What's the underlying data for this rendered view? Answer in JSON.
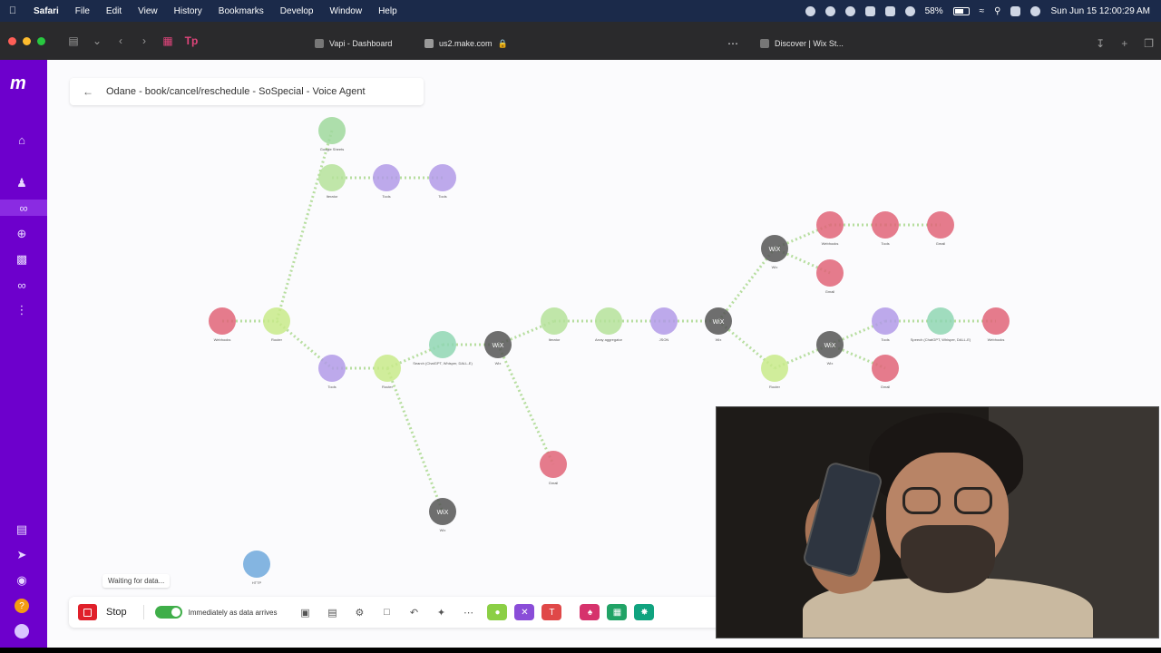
{
  "menubar": {
    "app_name": "Safari",
    "menus": [
      "File",
      "Edit",
      "View",
      "History",
      "Bookmarks",
      "Develop",
      "Window",
      "Help"
    ],
    "battery": "58%",
    "clock": "Sun Jun 15  12:00:29 AM"
  },
  "browser": {
    "tabs": [
      {
        "label": "Vapi - Dashboard"
      },
      {
        "label": "us2.make.com"
      },
      {
        "label": "Discover | Wix St..."
      }
    ]
  },
  "scenario": {
    "title": "Odane - book/cancel/reschedule - SoSpecial - Voice Agent",
    "waiting_text": "Waiting for data...",
    "nodes": [
      {
        "label": "Google Sheets",
        "color": "#9fd89c"
      },
      {
        "label": "Iterator",
        "color": "#b5e29a"
      },
      {
        "label": "Tools",
        "color": "#b29ae8"
      },
      {
        "label": "Tools",
        "color": "#b29ae8"
      },
      {
        "label": "Webhooks",
        "color": "#e06478"
      },
      {
        "label": "Router",
        "color": "#c8ea8a"
      },
      {
        "label": "Tools",
        "color": "#b29ae8"
      },
      {
        "label": "Router",
        "color": "#c8ea8a"
      },
      {
        "label": "Search (ChatGPT, Whisper, DALL-E)",
        "color": "#8fd6b3"
      },
      {
        "label": "Wix",
        "color": "#555555",
        "text": "WiX"
      },
      {
        "label": "Iterator",
        "color": "#b5e29a"
      },
      {
        "label": "Array aggregator",
        "color": "#b5e29a"
      },
      {
        "label": "JSON",
        "color": "#b29ae8"
      },
      {
        "label": "Wix",
        "color": "#555555",
        "text": "WiX"
      },
      {
        "label": "Wix",
        "color": "#555555",
        "text": "WiX"
      },
      {
        "label": "Webhooks",
        "color": "#e06478"
      },
      {
        "label": "Tools",
        "color": "#e06478"
      },
      {
        "label": "Gmail",
        "color": "#e06478"
      },
      {
        "label": "Gmail",
        "color": "#e06478"
      },
      {
        "label": "Wix",
        "color": "#555555",
        "text": "WiX"
      },
      {
        "label": "Tools",
        "color": "#b29ae8"
      },
      {
        "label": "Speech (ChatGPT, Whisper, DALL-E)",
        "color": "#8fd6b3"
      },
      {
        "label": "Webhooks",
        "color": "#e06478"
      },
      {
        "label": "Gmail",
        "color": "#e06478"
      },
      {
        "label": "Router",
        "color": "#c8ea8a"
      },
      {
        "label": "Gmail",
        "color": "#e06478"
      },
      {
        "label": "Wix",
        "color": "#555555",
        "text": "WiX"
      },
      {
        "label": "HTTP",
        "color": "#6fa8dc"
      }
    ]
  },
  "controls": {
    "stop_label": "Stop",
    "schedule_label": "Immediately as data arrives",
    "schedule_on": true
  },
  "colors": {
    "sidebar": "#6d00cc",
    "stop": "#e0202a",
    "toggle_on": "#3fae49"
  }
}
